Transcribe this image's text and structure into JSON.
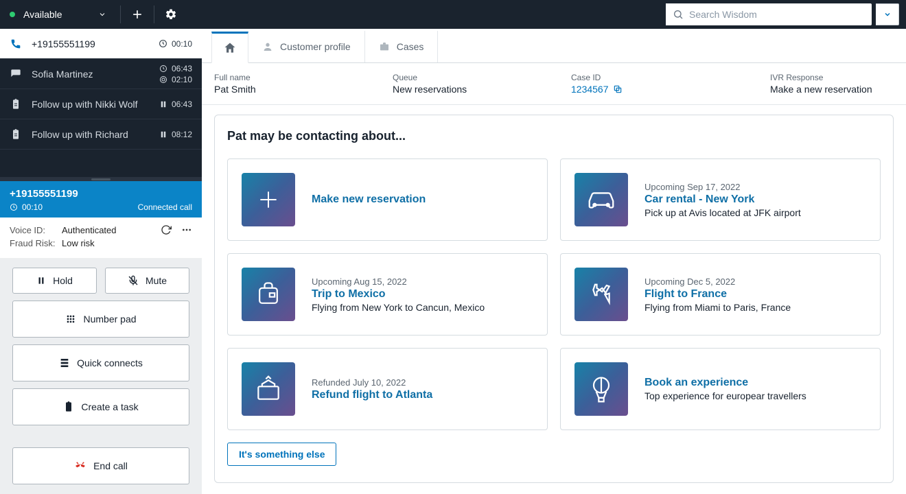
{
  "topbar": {
    "status": "Available",
    "search_placeholder": "Search Wisdom"
  },
  "sidebar": {
    "contacts": [
      {
        "icon": "phone",
        "label": "+19155551199",
        "t1": "00:10",
        "t1icon": "clock"
      },
      {
        "icon": "chat",
        "label": "Sofia Martinez",
        "t1": "06:43",
        "t1icon": "clock",
        "t2": "02:10",
        "t2icon": "target"
      },
      {
        "icon": "task",
        "label": "Follow up with Nikki Wolf",
        "t1": "06:43",
        "t1icon": "pause"
      },
      {
        "icon": "task",
        "label": "Follow up with Richard",
        "t1": "08:12",
        "t1icon": "pause"
      }
    ],
    "call_banner": {
      "number": "+19155551199",
      "timer": "00:10",
      "status": "Connected call"
    },
    "voice": {
      "voice_id_label": "Voice ID:",
      "voice_id_value": "Authenticated",
      "fraud_label": "Fraud Risk:",
      "fraud_value": "Low risk"
    },
    "controls": {
      "hold": "Hold",
      "mute": "Mute",
      "number_pad": "Number pad",
      "quick_connects": "Quick connects",
      "create_task": "Create a task",
      "end_call": "End call"
    }
  },
  "tabs": {
    "customer_profile": "Customer profile",
    "cases": "Cases"
  },
  "info": {
    "full_name_label": "Full name",
    "full_name": "Pat Smith",
    "queue_label": "Queue",
    "queue": "New reservations",
    "case_id_label": "Case ID",
    "case_id": "1234567",
    "ivr_label": "IVR Response",
    "ivr": "Make a new reservation"
  },
  "panel": {
    "title": "Pat may be contacting about...",
    "something_else": "It's something else",
    "cards": [
      {
        "meta": "",
        "title": "Make new reservation",
        "sub": ""
      },
      {
        "meta": "Upcoming Sep 17, 2022",
        "title": "Car rental - New York",
        "sub": "Pick up at Avis located at JFK airport"
      },
      {
        "meta": "Upcoming Aug 15, 2022",
        "title": "Trip to Mexico",
        "sub": "Flying from New York to Cancun, Mexico"
      },
      {
        "meta": "Upcoming Dec 5, 2022",
        "title": "Flight to France",
        "sub": "Flying from Miami to Paris, France"
      },
      {
        "meta": "Refunded July 10, 2022",
        "title": "Refund flight to Atlanta",
        "sub": ""
      },
      {
        "meta": "",
        "title": "Book an experience",
        "sub": "Top experience for europear travellers"
      }
    ]
  }
}
